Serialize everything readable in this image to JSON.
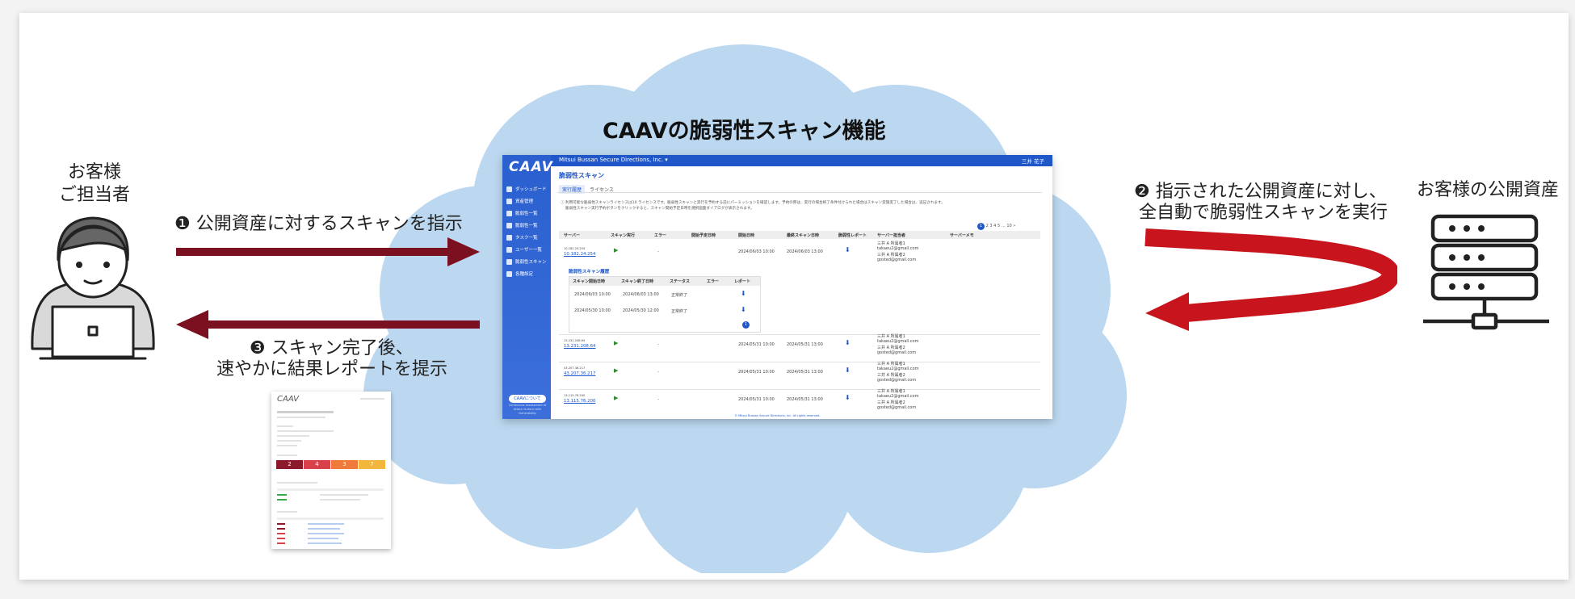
{
  "title": "CAAVの脆弱性スキャン機能",
  "customer_contact": "お客様\nご担当者",
  "customer_assets": "お客様の公開資産",
  "step1": "❶ 公開資産に対するスキャンを指示",
  "step2_line1": "❷ 指示された公開資産に対し、",
  "step2_line2": "全自動で脆弱性スキャンを実行",
  "step3_line1": "❸ スキャン完了後、",
  "step3_line2": "速やかに結果レポートを提示",
  "colors": {
    "arrow_dark": "#7a1020",
    "arrow_red": "#c8141c",
    "cloud": "#bcd8f0",
    "app_blue": "#1f57c9"
  },
  "icons": {
    "person": "person-with-laptop-icon",
    "server": "server-rack-icon"
  },
  "app": {
    "logo": "CAAV",
    "company": "Mitsui Bussan Secure Directions, Inc. ▾",
    "user": "三井 花子",
    "page_title": "脆弱性スキャン",
    "tabs": [
      "実行履歴",
      "ライセンス"
    ],
    "sidebar": [
      "ダッシュボード",
      "資産管理",
      "脆弱性一覧",
      "脆弱性一覧",
      "タスク一覧",
      "ユーザー一覧",
      "脆弱性スキャン",
      "各種設定"
    ],
    "sidebar_button": "CAAVについて",
    "sidebar_footer": "Continuous Assessment of Attack Surface with Vulnerability",
    "note_line1": "ⓘ 利用可能な脆弱性スキャンライセンスは10 ライセンスです。脆弱性スキャンと実行を予約する前にパーミッションを確認します。予約の際は、実行の場合終了条件付けられた場合はスキャン実施実了した場合は、追記されます。",
    "note_line2": "脆弱性スキャン実行予約ボタンをクリックすると、スキャン開始予定日時を選択画面ダイアログが表示されます。",
    "pager": [
      "1",
      "2",
      "3",
      "4",
      "5",
      "…",
      "10",
      "»"
    ],
    "columns": [
      "サーバー",
      "スキャン実行",
      "エラー",
      "開始予定日時",
      "開始日時",
      "最終スキャン日時",
      "脆弱性レポート",
      "サーバー担当者",
      "サーバーメモ"
    ],
    "rows": [
      {
        "label": "10.182.24.254",
        "ip": "10.182.24.254",
        "dash": "-",
        "start": "2024/06/03 10:00",
        "last": "2024/06/03 13:00",
        "owner1": "三井 A 所属者1",
        "mail1": "takaeu2@gmail.com",
        "owner2": "三井 A 所属者2",
        "mail2": "gosted@gmail.com"
      },
      {
        "label": "13.231.208.64",
        "ip": "13.231.208.64",
        "dash": "-",
        "start": "2024/05/31 10:00",
        "last": "2024/05/31 13:00",
        "owner1": "三井 A 所属者1",
        "mail1": "takaeu2@gmail.com",
        "owner2": "三井 A 所属者2",
        "mail2": "gosted@gmail.com"
      },
      {
        "label": "43.207.36.217",
        "ip": "43.207.36.217",
        "dash": "-",
        "start": "2024/05/31 10:00",
        "last": "2024/05/31 13:00",
        "owner1": "三井 A 所属者1",
        "mail1": "takaeu2@gmail.com",
        "owner2": "三井 A 所属者2",
        "mail2": "gosted@gmail.com"
      },
      {
        "label": "13.115.76.200",
        "ip": "13.115.76.200",
        "dash": "-",
        "start": "2024/05/31 10:00",
        "last": "2024/05/31 13:00",
        "owner1": "三井 A 所属者1",
        "mail1": "takaeu2@gmail.com",
        "owner2": "三井 A 所属者2",
        "mail2": "gosted@gmail.com"
      }
    ],
    "history_title": "脆弱性スキャン履歴",
    "history_columns": [
      "スキャン開始日時",
      "スキャン終了日時",
      "ステータス",
      "エラー",
      "レポート"
    ],
    "history_rows": [
      {
        "start": "2024/06/03 10:00",
        "end": "2024/06/03 13:00",
        "status": "正常終了"
      },
      {
        "start": "2024/05/30 10:00",
        "end": "2024/05/30 12:00",
        "status": "正常終了"
      }
    ],
    "history_pager": "1",
    "copyright": "© Mitsui Bussan Secure Directions, Inc. All rights reserved."
  },
  "report": {
    "logo": "CAAV",
    "severity_counts": [
      "2",
      "4",
      "3",
      "7"
    ],
    "severity_colors": [
      "#8b1a2b",
      "#d8414a",
      "#f07a3c",
      "#f2b63c"
    ]
  }
}
